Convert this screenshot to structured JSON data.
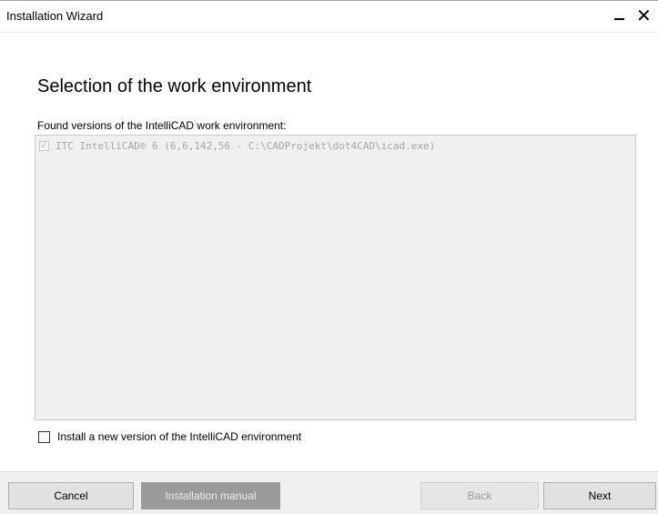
{
  "window": {
    "title": "Installation Wizard",
    "minimize_glyph": "—",
    "close_glyph": "✕"
  },
  "main": {
    "heading": "Selection of the work environment",
    "found_label": "Found versions of the IntelliCAD work environment:",
    "found_versions": [
      {
        "label": "ITC IntelliCAD® 6 (6,6,142,56 - C:\\CADProjekt\\dot4CAD\\icad.exe)",
        "checked": true,
        "enabled": false
      }
    ],
    "new_version_label": "Install a new version of the IntelliCAD environment",
    "new_version_checked": false
  },
  "footer": {
    "cancel_label": "Cancel",
    "manual_label": "Installation manual",
    "back_label": "Back",
    "next_label": "Next"
  },
  "colors": {
    "window_bg": "#f0f0f0",
    "content_bg": "#ffffff",
    "manual_button_bg": "#9a9a9a",
    "disabled_text": "#a6a6a6"
  }
}
